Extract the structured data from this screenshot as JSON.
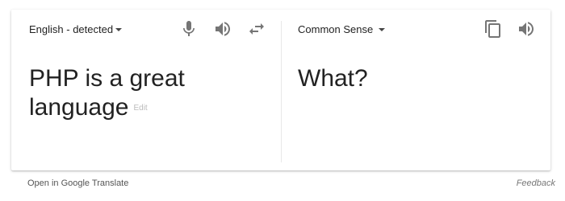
{
  "source": {
    "language_label": "English - detected",
    "text": "PHP is a great language",
    "edit_label": "Edit",
    "icons": [
      "microphone-icon",
      "speaker-icon",
      "swap-arrows-icon"
    ]
  },
  "target": {
    "language_label": "Common Sense",
    "text": "What?",
    "icons": [
      "copy-icon",
      "speaker-icon"
    ]
  },
  "footer": {
    "open_label": "Open in Google Translate",
    "feedback_label": "Feedback"
  },
  "colors": {
    "text": "#222222",
    "icon": "#757575",
    "muted": "#bbbbbb"
  }
}
